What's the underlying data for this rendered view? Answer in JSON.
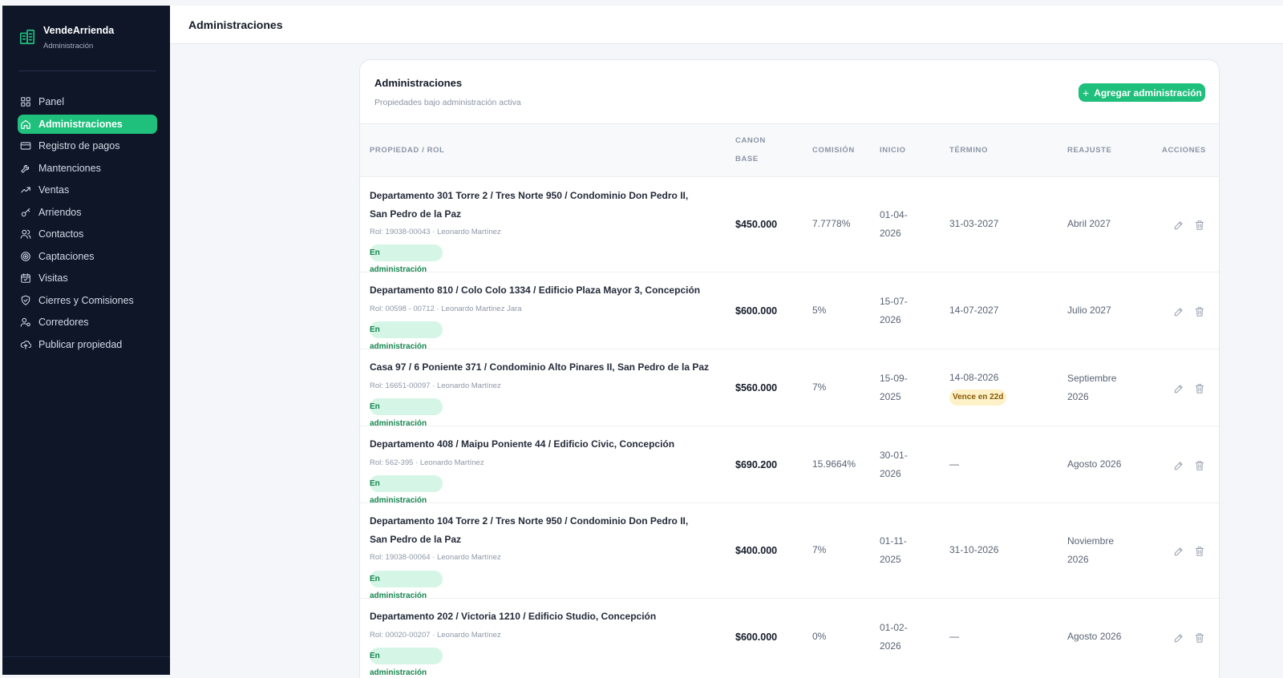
{
  "app": {
    "name": "VendeArrienda",
    "subtitle": "Administración"
  },
  "sidebar": {
    "items": [
      {
        "label": "Panel",
        "icon": "grid-icon"
      },
      {
        "label": "Administraciones",
        "icon": "home-icon",
        "active": true
      },
      {
        "label": "Registro de pagos",
        "icon": "credit-card-icon"
      },
      {
        "label": "Mantenciones",
        "icon": "wrench-icon"
      },
      {
        "label": "Ventas",
        "icon": "trending-up-icon"
      },
      {
        "label": "Arriendos",
        "icon": "key-icon"
      },
      {
        "label": "Contactos",
        "icon": "users-icon"
      },
      {
        "label": "Captaciones",
        "icon": "target-icon"
      },
      {
        "label": "Visitas",
        "icon": "calendar-icon"
      },
      {
        "label": "Cierres y Comisiones",
        "icon": "handshake-icon"
      },
      {
        "label": "Corredores",
        "icon": "user-cog-icon"
      },
      {
        "label": "Publicar propiedad",
        "icon": "upload-cloud-icon"
      }
    ]
  },
  "header": {
    "title": "Administraciones"
  },
  "card": {
    "title": "Administraciones",
    "subtitle": "Propiedades bajo administración activa",
    "add_label": "Agregar administración"
  },
  "table": {
    "columns": {
      "propiedad": "PROPIEDAD / ROL",
      "canon_1": "CANON",
      "canon_2": "BASE",
      "comision": "COMISIÓN",
      "inicio": "INICIO",
      "termino": "TÉRMINO",
      "reajuste": "REAJUSTE",
      "acciones": "ACCIONES"
    },
    "rows": [
      {
        "prop_1": "Departamento 301 Torre 2 / Tres Norte 950 / Condominio Don Pedro II,",
        "prop_2": "San Pedro de la Paz",
        "rol": "Rol: 19038-00043 · Leonardo Martínez",
        "estado": "En administración",
        "canon": "$450.000",
        "comision": "7.7778%",
        "inicio_1": "01-04-",
        "inicio_2": "2026",
        "termino": "31-03-2027",
        "aviso": "",
        "reajuste_1": "Abril 2027",
        "reajuste_2": ""
      },
      {
        "prop_1": "Departamento 810 / Colo Colo 1334 / Edificio Plaza Mayor 3, Concepción",
        "prop_2": "",
        "rol": "Rol: 00598 - 00712 · Leonardo Martinez Jara",
        "estado": "En administración",
        "canon": "$600.000",
        "comision": "5%",
        "inicio_1": "15-07-",
        "inicio_2": "2026",
        "termino": "14-07-2027",
        "aviso": "",
        "reajuste_1": "Julio 2027",
        "reajuste_2": ""
      },
      {
        "prop_1": "Casa 97 / 6 Poniente 371 / Condominio Alto Pinares II, San Pedro de la Paz",
        "prop_2": "",
        "rol": "Rol: 16651-00097 · Leonardo Martínez",
        "estado": "En administración",
        "canon": "$560.000",
        "comision": "7%",
        "inicio_1": "15-09-",
        "inicio_2": "2025",
        "termino": "14-08-2026",
        "aviso": "Vence en 22d",
        "reajuste_1": "Septiembre",
        "reajuste_2": "2026"
      },
      {
        "prop_1": "Departamento 408 / Maipu Poniente 44 / Edificio Civic, Concepción",
        "prop_2": "",
        "rol": "Rol: 562-395 · Leonardo Martínez",
        "estado": "En administración",
        "canon": "$690.200",
        "comision": "15.9664%",
        "inicio_1": "30-01-",
        "inicio_2": "2026",
        "termino": "—",
        "aviso": "",
        "reajuste_1": "Agosto 2026",
        "reajuste_2": ""
      },
      {
        "prop_1": "Departamento 104 Torre 2 / Tres Norte 950 / Condominio Don Pedro II,",
        "prop_2": "San Pedro de la Paz",
        "rol": "Rol: 19038-00064 · Leonardo Martínez",
        "estado": "En administración",
        "canon": "$400.000",
        "comision": "7%",
        "inicio_1": "01-11-",
        "inicio_2": "2025",
        "termino": "31-10-2026",
        "aviso": "",
        "reajuste_1": "Noviembre",
        "reajuste_2": "2026"
      },
      {
        "prop_1": "Departamento 202 / Victoria 1210 / Edificio Studio, Concepción",
        "prop_2": "",
        "rol": "Rol: 00020-00207 · Leonardo Martínez",
        "estado": "En administración",
        "canon": "$600.000",
        "comision": "0%",
        "inicio_1": "01-02-",
        "inicio_2": "2026",
        "termino": "—",
        "aviso": "",
        "reajuste_1": "Agosto 2026",
        "reajuste_2": ""
      }
    ]
  }
}
